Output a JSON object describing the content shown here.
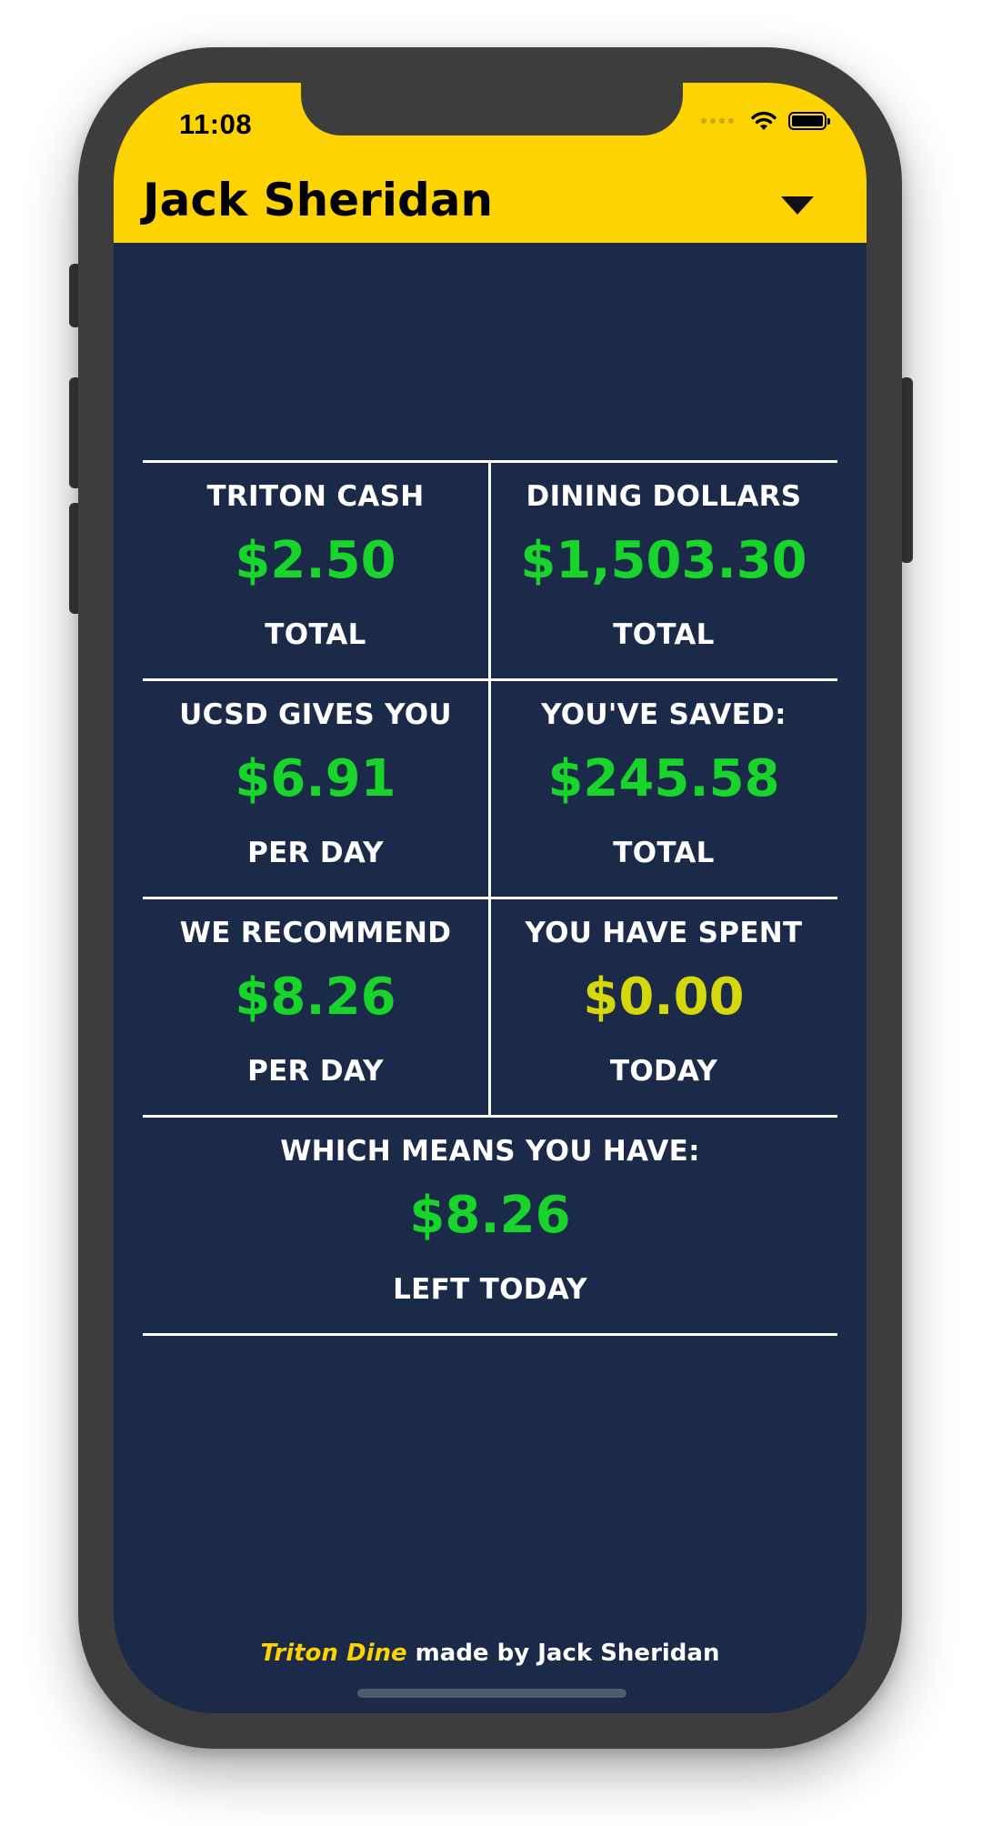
{
  "status_bar": {
    "time": "11:08"
  },
  "header": {
    "title": "Jack Sheridan",
    "background": "#fed302",
    "dropdown_icon": "caret-down-icon"
  },
  "colors": {
    "screen_background": "#1b2a48",
    "positive_value": "#19d42b",
    "neutral_value": "#d5d80c",
    "label_text": "#ffffff"
  },
  "stats": {
    "triton_cash": {
      "label": "TRITON CASH",
      "value": "$2.50",
      "sub": "TOTAL"
    },
    "dining_dollars": {
      "label": "DINING DOLLARS",
      "value": "$1,503.30",
      "sub": "TOTAL"
    },
    "ucsd_gives": {
      "label": "UCSD GIVES YOU",
      "value": "$6.91",
      "sub": "PER DAY"
    },
    "saved": {
      "label": "YOU'VE SAVED:",
      "value": "$245.58",
      "sub": "TOTAL"
    },
    "recommend": {
      "label": "WE RECOMMEND",
      "value": "$8.26",
      "sub": "PER DAY"
    },
    "spent": {
      "label": "YOU HAVE SPENT",
      "value": "$0.00",
      "sub": "TODAY"
    },
    "left": {
      "label": "WHICH MEANS YOU HAVE:",
      "value": "$8.26",
      "sub": "LEFT TODAY"
    }
  },
  "footer": {
    "brand": "Triton Dine",
    "rest": " made by Jack Sheridan"
  }
}
